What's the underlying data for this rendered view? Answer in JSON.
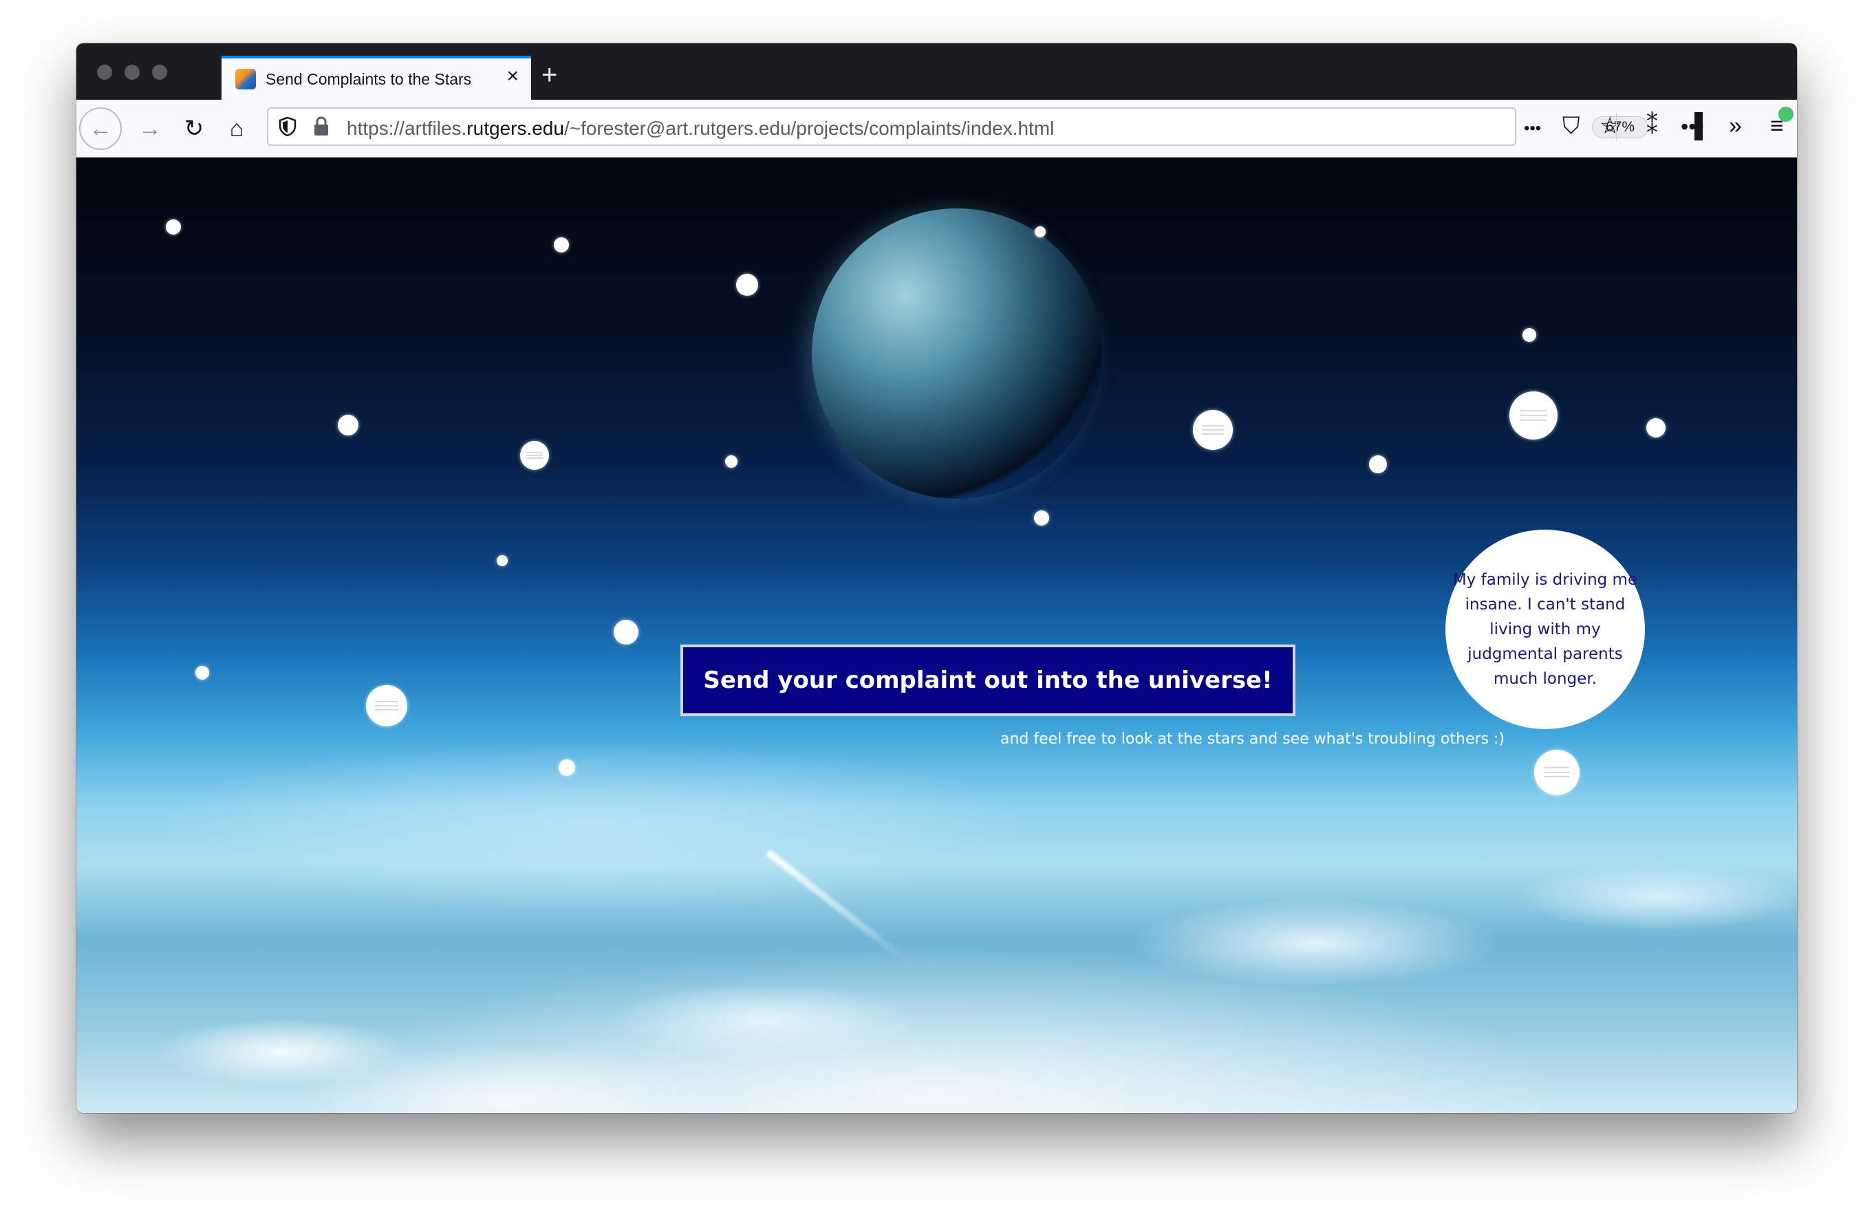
{
  "browser": {
    "tab": {
      "title": "Send Complaints to the Stars",
      "close_icon": "×"
    },
    "new_tab_icon": "+",
    "nav": {
      "back_icon": "←",
      "forward_icon": "→",
      "reload_icon": "↻",
      "home_icon": "⌂"
    },
    "url": {
      "prefix": "https://artfiles.",
      "domain": "rutgers.edu",
      "path": "/~forester@art.rutgers.edu/projects/complaints/index.html"
    },
    "zoom": "67%",
    "url_actions": {
      "more_icon": "•••",
      "pocket_icon": "⛉",
      "bookmark_icon": "☆"
    },
    "toolbar": {
      "extension_icon": "⁑",
      "sidebar_icon": "▐",
      "overflow_icon": "»",
      "menu_icon": "≡"
    }
  },
  "page": {
    "main_button": "Send your complaint out into the universe!",
    "subtext": "and feel free to look at the stars and see what's troubling others :)",
    "open_complaint": "My family is driving me insane. I can't stand living with my judgmental parents much longer."
  },
  "colors": {
    "button_bg": "#060385",
    "bubble_text": "#1b1a72",
    "tab_accent": "#0a84ff"
  }
}
